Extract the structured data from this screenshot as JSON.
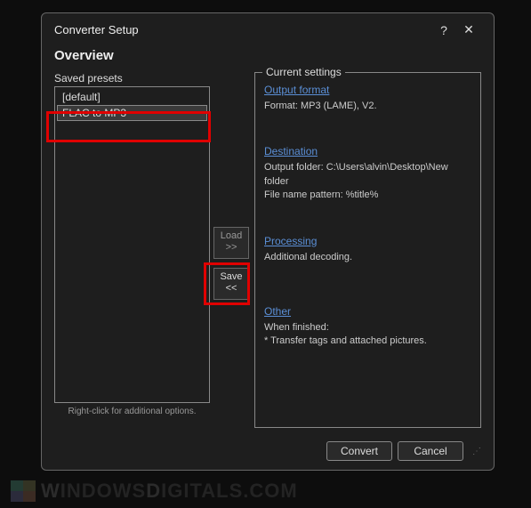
{
  "dialog": {
    "title": "Converter Setup",
    "subtitle": "Overview"
  },
  "presets": {
    "label": "Saved presets",
    "items": [
      {
        "label": "[default]"
      },
      {
        "label": "FLAC to MP3"
      }
    ],
    "hint": "Right-click for additional options."
  },
  "buttons": {
    "load_label": "Load",
    "load_arrows": ">>",
    "save_label": "Save",
    "save_arrows": "<<"
  },
  "settings": {
    "label": "Current settings",
    "output_format": {
      "link": "Output format",
      "text": "Format: MP3 (LAME), V2."
    },
    "destination": {
      "link": "Destination",
      "line1": "Output folder: C:\\Users\\alvin\\Desktop\\New folder",
      "line2": "File name pattern: %title%"
    },
    "processing": {
      "link": "Processing",
      "text": "Additional decoding."
    },
    "other": {
      "link": "Other",
      "line1": "When finished:",
      "line2": "* Transfer tags and attached pictures."
    }
  },
  "footer": {
    "convert_label": "Convert",
    "cancel_label": "Cancel"
  },
  "watermark": {
    "text": "WindowsDigitals.com"
  }
}
